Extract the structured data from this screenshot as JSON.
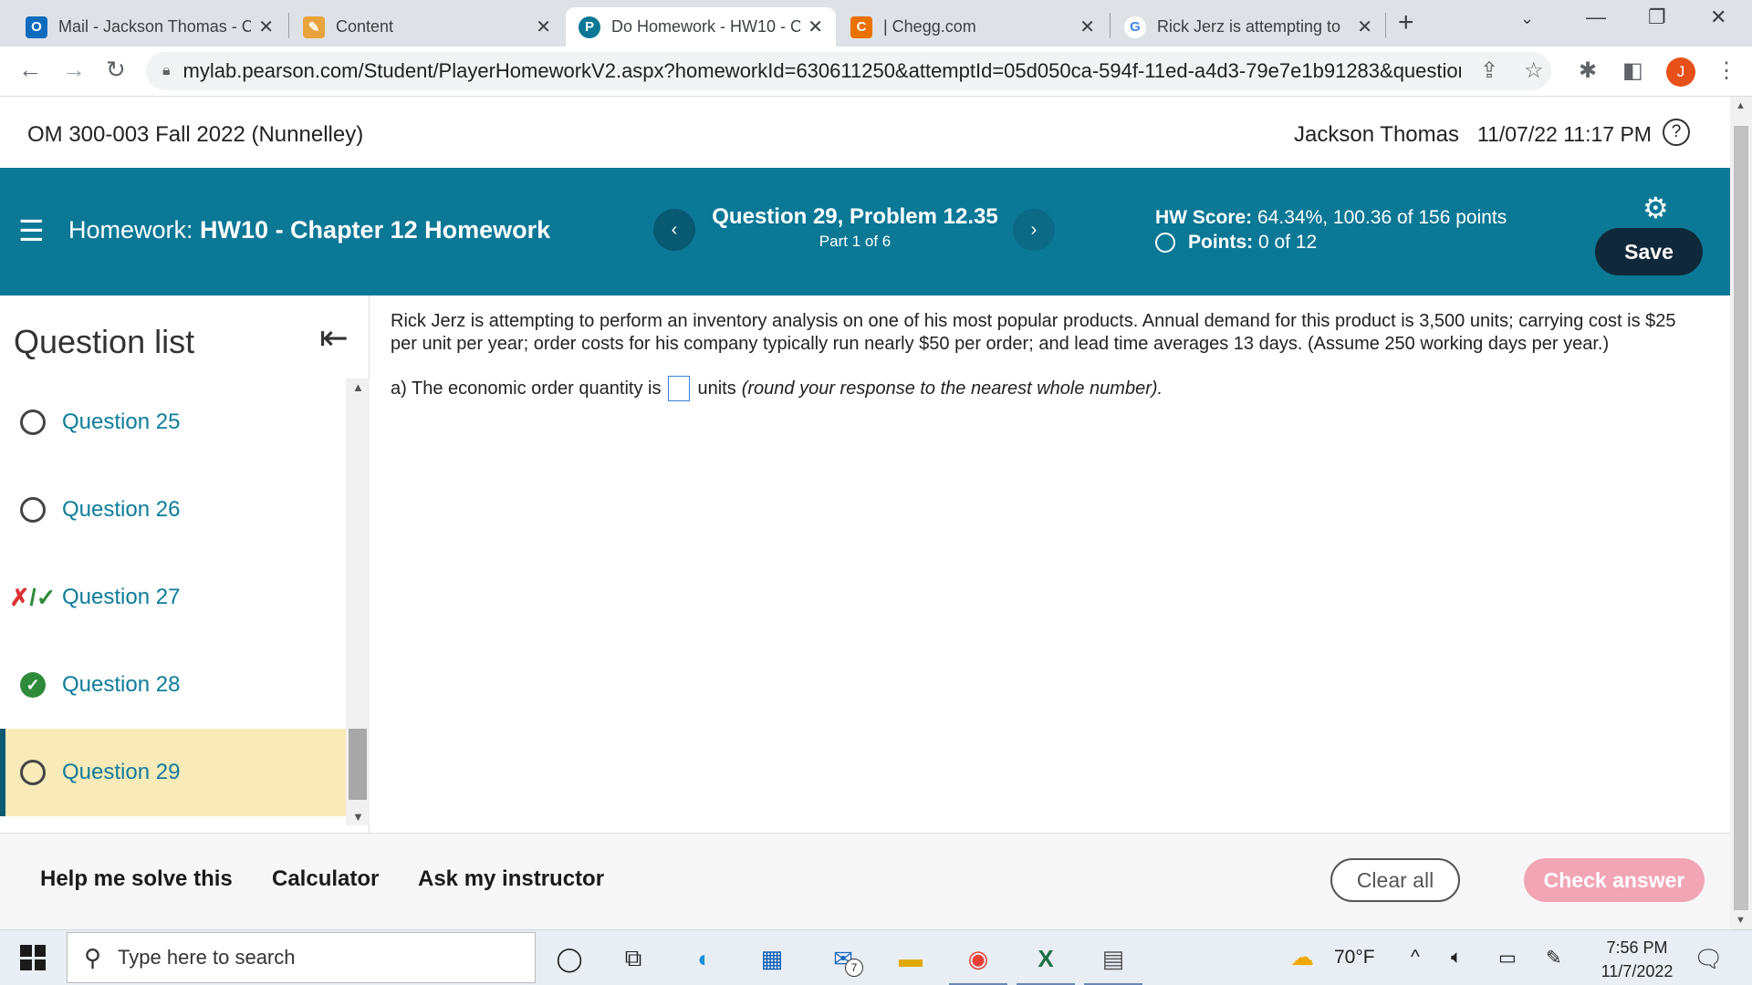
{
  "browser": {
    "tabs": [
      {
        "title": "Mail - Jackson Thomas - C",
        "icon": "outlook-icon",
        "color": "#0f6cbd"
      },
      {
        "title": "Content",
        "icon": "pencil-icon",
        "color": "#e8a33d"
      },
      {
        "title": "Do Homework - HW10 - C",
        "icon": "pearson-icon",
        "color": "#0b7896",
        "active": true
      },
      {
        "title": "| Chegg.com",
        "icon": "chegg-icon",
        "color": "#eb7100"
      },
      {
        "title": "Rick Jerz is attempting to",
        "icon": "google-icon",
        "color": "#4285f4"
      }
    ],
    "url": "mylab.pearson.com/Student/PlayerHomeworkV2.aspx?homeworkId=630611250&attemptId=05d050ca-594f-11ed-a4d3-79e7e1b91283&questionId...",
    "profile_initial": "J"
  },
  "header": {
    "course": "OM 300-003 Fall 2022 (Nunnelley)",
    "user": "Jackson Thomas",
    "datetime": "11/07/22 11:17 PM",
    "help": "?"
  },
  "hwbar": {
    "label": "Homework:",
    "name": "HW10 - Chapter 12 Homework",
    "question_title": "Question 29, Problem 12.35",
    "part": "Part 1 of 6",
    "score_label": "HW Score:",
    "score_value": "64.34%, 100.36 of 156 points",
    "points_label": "Points:",
    "points_value": "0 of 12",
    "save": "Save",
    "prev": "‹",
    "next": "›"
  },
  "question_list": {
    "title": "Question list",
    "items": [
      {
        "label": "Question 25",
        "status": "empty"
      },
      {
        "label": "Question 26",
        "status": "empty"
      },
      {
        "label": "Question 27",
        "status": "partial"
      },
      {
        "label": "Question 28",
        "status": "correct"
      },
      {
        "label": "Question 29",
        "status": "empty",
        "current": true
      }
    ]
  },
  "question": {
    "text": "Rick Jerz is attempting to perform an inventory analysis on one of his most popular products. Annual demand for this product is 3,500 units; carrying cost is $25 per unit per year; order costs for his company typically run nearly $50 per order; and lead time averages 13 days. (Assume 250 working days per year.)",
    "part_a_prefix": "a) The economic order quantity is",
    "part_a_unit": "units",
    "part_a_hint": "(round your response to the nearest whole number)."
  },
  "footer": {
    "help": "Help me solve this",
    "calculator": "Calculator",
    "ask": "Ask my instructor",
    "clear": "Clear all",
    "check": "Check answer"
  },
  "taskbar": {
    "search_placeholder": "Type here to search",
    "mail_badge": "7",
    "weather": "70°F",
    "time": "7:56 PM",
    "date": "11/7/2022"
  }
}
